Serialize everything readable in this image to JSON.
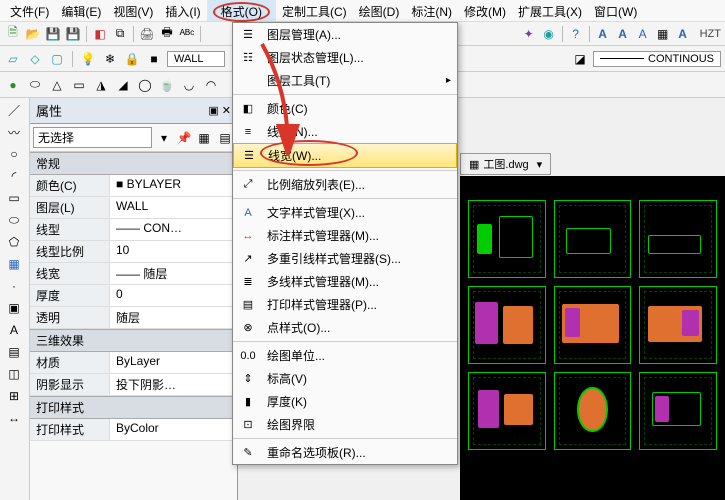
{
  "menubar": {
    "items": [
      {
        "label": "文件(F)"
      },
      {
        "label": "编辑(E)"
      },
      {
        "label": "视图(V)"
      },
      {
        "label": "插入(I)"
      },
      {
        "label": "格式(O)"
      },
      {
        "label": "定制工具(C)"
      },
      {
        "label": "绘图(D)"
      },
      {
        "label": "标注(N)"
      },
      {
        "label": "修改(M)"
      },
      {
        "label": "扩展工具(X)"
      },
      {
        "label": "窗口(W)"
      }
    ]
  },
  "toolbar_row2": {
    "wall_label": "WALL",
    "linestyle_label": "CONTINOUS",
    "hzt_label": "HZT"
  },
  "properties": {
    "title": "属性",
    "selection": "无选择",
    "categories": [
      {
        "name": "常规",
        "rows": [
          {
            "label": "颜色(C)",
            "value": "■ BYLAYER"
          },
          {
            "label": "图层(L)",
            "value": "WALL"
          },
          {
            "label": "线型",
            "value": "—— CON…"
          },
          {
            "label": "线型比例",
            "value": "10"
          },
          {
            "label": "线宽",
            "value": "—— 随层"
          },
          {
            "label": "厚度",
            "value": "0"
          },
          {
            "label": "透明",
            "value": "随层"
          }
        ]
      },
      {
        "name": "三维效果",
        "rows": [
          {
            "label": "材质",
            "value": "ByLayer"
          },
          {
            "label": "阴影显示",
            "value": "投下阴影…"
          }
        ]
      },
      {
        "name": "打印样式",
        "rows": [
          {
            "label": "打印样式",
            "value": "ByColor"
          }
        ]
      }
    ]
  },
  "dropdown": {
    "items": [
      {
        "label": "图层管理(A)...",
        "icon": "layers-icon"
      },
      {
        "label": "图层状态管理(L)...",
        "icon": "layersstate-icon"
      },
      {
        "label": "图层工具(T)",
        "icon": "",
        "submenu": true
      },
      {
        "label": "-"
      },
      {
        "label": "颜色(C)",
        "icon": "color-icon"
      },
      {
        "label": "线型(N)...",
        "icon": "linetype-icon"
      },
      {
        "label": "线宽(W)...",
        "icon": "lineweight-icon",
        "highlight": true
      },
      {
        "label": "-"
      },
      {
        "label": "比例缩放列表(E)...",
        "icon": "scale-icon"
      },
      {
        "label": "-"
      },
      {
        "label": "文字样式管理(X)...",
        "icon": "textstyle-icon"
      },
      {
        "label": "标注样式管理器(M)...",
        "icon": "dimstyle-icon"
      },
      {
        "label": "多重引线样式管理器(S)...",
        "icon": "mleaderstyle-icon"
      },
      {
        "label": "多线样式管理器(M)...",
        "icon": "mlinestyle-icon"
      },
      {
        "label": "打印样式管理器(P)...",
        "icon": "plotstyle-icon"
      },
      {
        "label": "点样式(O)...",
        "icon": "pointstyle-icon"
      },
      {
        "label": "-"
      },
      {
        "label": "绘图单位...",
        "icon": "units-icon"
      },
      {
        "label": "标高(V)",
        "icon": "elev-icon"
      },
      {
        "label": "厚度(K)",
        "icon": "thickness-icon"
      },
      {
        "label": "绘图界限",
        "icon": "limits-icon"
      },
      {
        "label": "-"
      },
      {
        "label": "重命名选项板(R)...",
        "icon": "rename-icon"
      }
    ]
  },
  "drawing": {
    "tab_label": "工图.dwg"
  }
}
